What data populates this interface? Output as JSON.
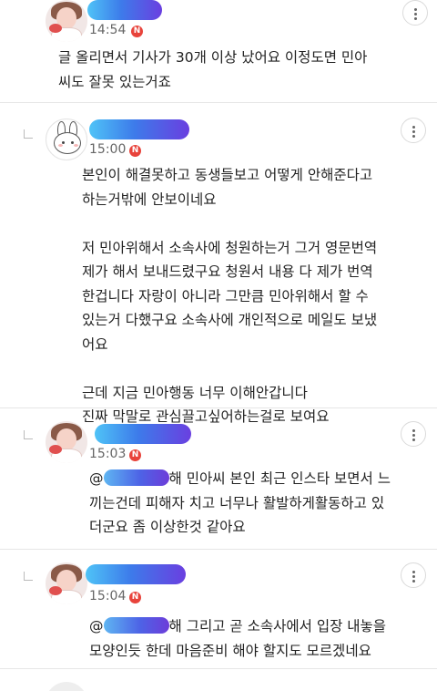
{
  "comments": [
    {
      "time": "14:54",
      "badge": "N",
      "text": "글 올리면서 기사가 30개 이상 났어요 이정도면 민아\n씨도 잘못 있는거죠"
    },
    {
      "time": "15:00",
      "badge": "N",
      "text": "본인이 해결못하고 동생들보고 어떻게 안해준다고\n하는거밖에 안보이네요\n\n저 민아위해서 소속사에 청원하는거 그거 영문번역\n제가 해서 보내드렸구요 청원서 내용 다 제가 번역\n한겁니다 자랑이 아니라 그만큼 민아위해서 할 수\n있는거 다했구요 소속사에 개인적으로 메일도 보냈\n어요\n\n근데 지금 민아행동 너무 이해안갑니다\n진짜 막말로 관심끌고싶어하는걸로 보여요"
    },
    {
      "time": "15:03",
      "badge": "N",
      "mention_prefix": "@",
      "mention_suffix": "해",
      "text_line1": " 민아씨 본인 최근 인스타 보면서 느",
      "text_rest": "끼는건데 피해자 치고 너무나 활발하게활동하고 있\n더군요 좀 이상한것 같아요"
    },
    {
      "time": "15:04",
      "badge": "N",
      "mention_prefix": "@",
      "mention_suffix": "해",
      "text_line1": "  그리고 곧 소속사에서 입장 내놓을",
      "text_rest": "모양인듯 한데 마음준비 해야 할지도 모르겠네요"
    }
  ],
  "icons": {
    "more": "more-vertical-icon",
    "reply": "reply-indent-icon",
    "badge": "new-badge-icon"
  },
  "colors": {
    "badge": "#e8433b",
    "blur_start": "#4fc3f7",
    "blur_end": "#6a3fe0",
    "divider": "#e6e6e6"
  }
}
